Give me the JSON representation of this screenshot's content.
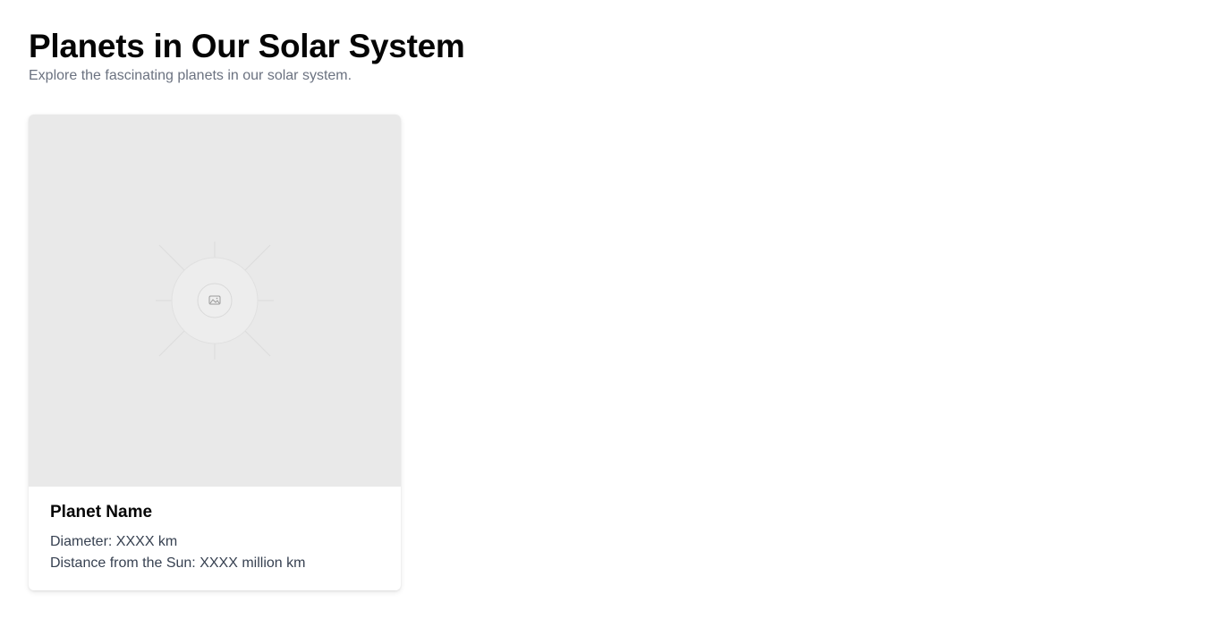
{
  "header": {
    "title": "Planets in Our Solar System",
    "subtitle": "Explore the fascinating planets in our solar system."
  },
  "planets": [
    {
      "name": "Planet Name",
      "diameter": "Diameter: XXXX km",
      "distance": "Distance from the Sun: XXXX million km",
      "image_icon": "image-placeholder-icon"
    }
  ],
  "colors": {
    "title": "#050505",
    "subtitle": "#6b7280",
    "card_image_bg": "#e9e9e9",
    "card_text": "#374151"
  }
}
